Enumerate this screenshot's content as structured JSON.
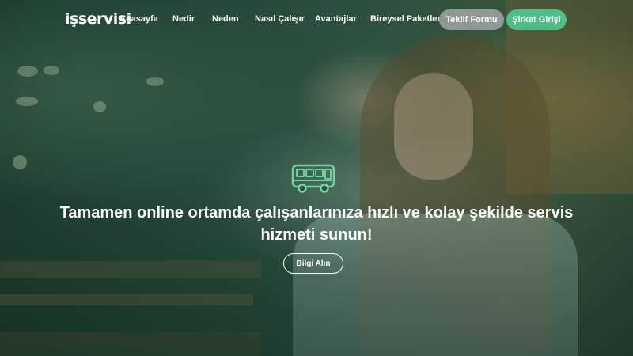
{
  "brand": {
    "logo_text": "işservisi"
  },
  "nav": {
    "links": [
      "Anasayfa",
      "Nedir",
      "Neden",
      "Nasıl Çalışır",
      "Avantajlar",
      "Bireysel Paketler"
    ],
    "quote_button": "Teklif Formu",
    "login_button": "Şirket Girişi"
  },
  "hero": {
    "icon": "bus-icon",
    "headline": "Tamamen online ortamda çalışanlarınıza hızlı ve kolay şekilde servis hizmeti sunun!",
    "cta_button": "Bilgi Alın"
  },
  "colors": {
    "accent": "#4fbd8a",
    "secondary_button": "#8f9a95",
    "icon_color": "#6fd3a0",
    "text": "#ffffff"
  }
}
